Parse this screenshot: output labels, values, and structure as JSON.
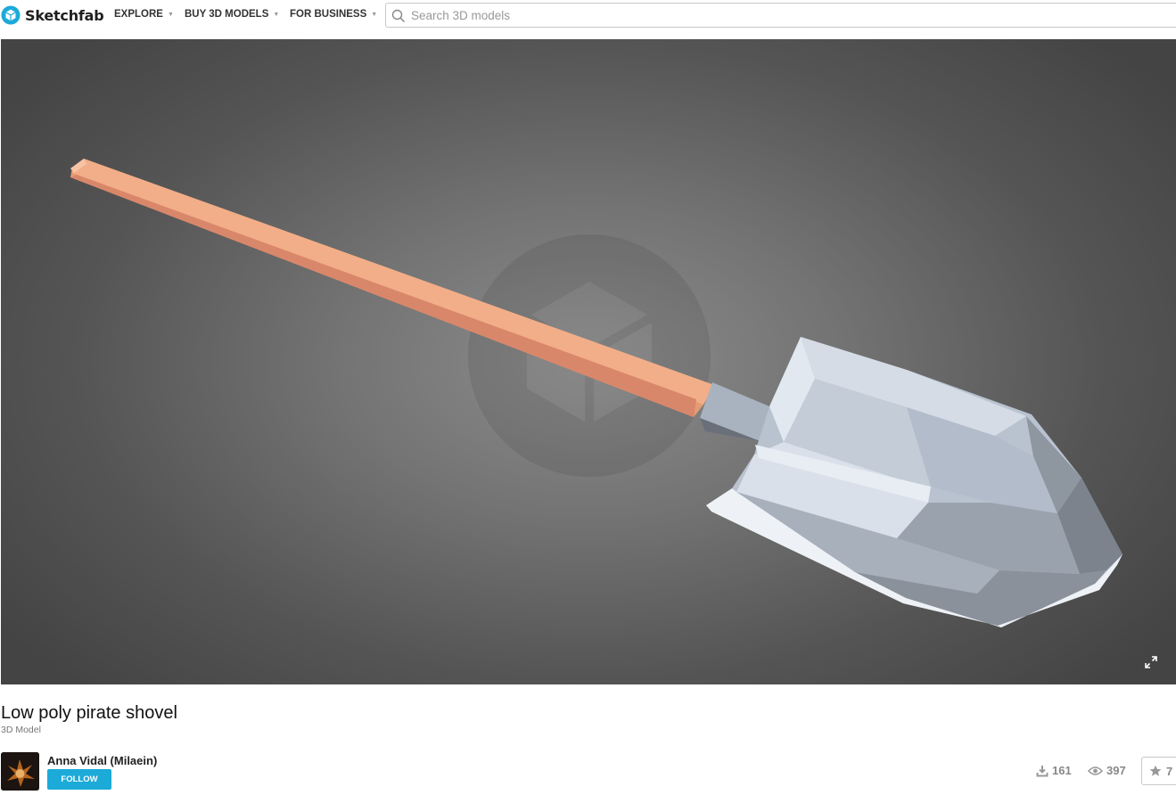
{
  "header": {
    "logo_text": "Sketchfab",
    "brand_color": "#1caad9",
    "nav": [
      {
        "label": "EXPLORE",
        "icon": "caret-down-icon"
      },
      {
        "label": "BUY 3D MODELS",
        "icon": "caret-down-icon"
      },
      {
        "label": "FOR BUSINESS",
        "icon": "caret-down-icon"
      }
    ],
    "search": {
      "placeholder": "Search 3D models",
      "value": "",
      "icon": "search-icon"
    }
  },
  "viewer": {
    "model_colors": {
      "handle": "#f0a880",
      "blade": "#c3ccd8",
      "background": "#6e6e6e"
    },
    "fullscreen_icon": "fullscreen-icon"
  },
  "model": {
    "title": "Low poly pirate shovel",
    "type": "3D Model",
    "author": {
      "name": "Anna Vidal (Milaein)",
      "follow_label": "FOLLOW",
      "avatar_icon": "user-avatar"
    },
    "stats": {
      "downloads": "161",
      "views": "397",
      "likes": "7"
    }
  }
}
